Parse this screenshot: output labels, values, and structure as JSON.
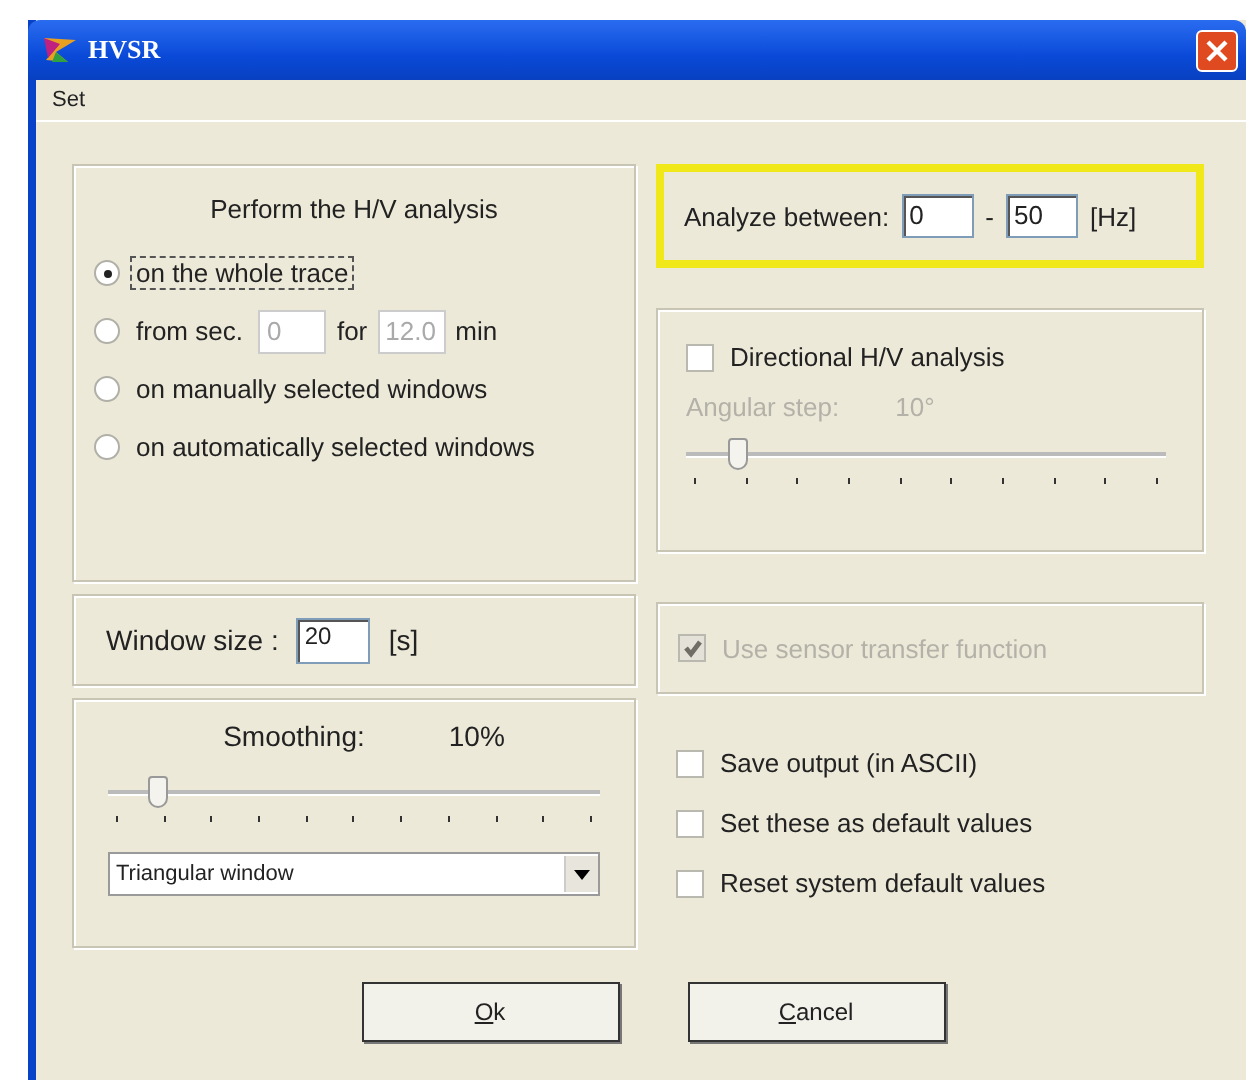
{
  "window": {
    "title": "HVSR"
  },
  "menu": [
    "Set"
  ],
  "analysis": {
    "title": "Perform the H/V analysis",
    "options": [
      {
        "kind": "plain",
        "label": "on the whole trace",
        "selected": true,
        "focused": true
      },
      {
        "kind": "range",
        "label": "from sec.",
        "from": "0",
        "for_label": "for",
        "duration": "12.0",
        "unit": "min",
        "fields_disabled": true,
        "selected": false,
        "focused": false
      },
      {
        "kind": "plain",
        "label": "on manually selected windows",
        "selected": false,
        "focused": false
      },
      {
        "kind": "plain",
        "label": "on automatically selected windows",
        "selected": false,
        "focused": false
      }
    ]
  },
  "analyze": {
    "label": "Analyze between:",
    "from": "0",
    "separator": "-",
    "to": "50",
    "unit": "[Hz]",
    "highlighted": true
  },
  "directional": {
    "label": "Directional H/V analysis",
    "checked": false,
    "step_label": "Angular step:",
    "step_value": "10°",
    "disabled": true,
    "level": 0.11
  },
  "window_size": {
    "label": "Window size :",
    "value": "20",
    "unit": "[s]"
  },
  "sensor": {
    "label": "Use sensor transfer function",
    "checked": true,
    "disabled": true
  },
  "smoothing": {
    "label": "Smoothing:",
    "value": "10%",
    "level": 0.1,
    "window_type": "Triangular window"
  },
  "options": [
    {
      "label": "Save output (in ASCII)",
      "checked": false
    },
    {
      "label": "Set these as default values",
      "checked": false
    },
    {
      "label": "Reset system default values",
      "checked": false
    }
  ],
  "buttons": [
    {
      "label": "Ok"
    },
    {
      "label": "Cancel"
    }
  ]
}
